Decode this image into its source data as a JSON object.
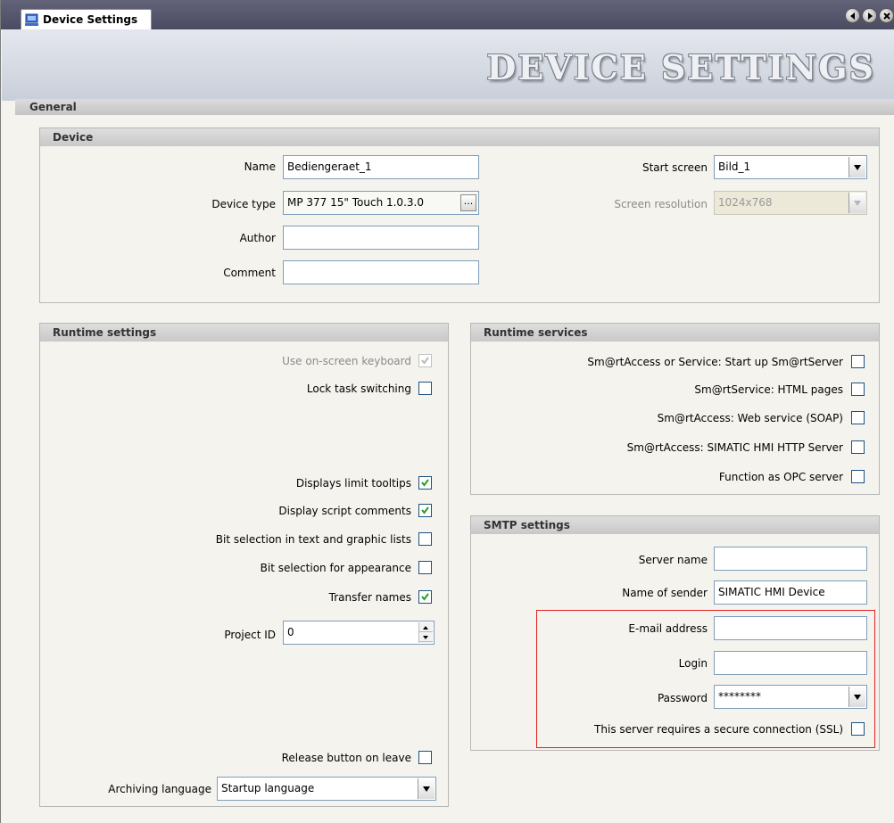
{
  "tab": {
    "title": "Device Settings"
  },
  "header": {
    "title": "DEVICE SETTINGS"
  },
  "general": {
    "label": "General"
  },
  "device": {
    "heading": "Device",
    "name_label": "Name",
    "name_value": "Bediengeraet_1",
    "device_type_label": "Device type",
    "device_type_value": "MP 377 15\" Touch 1.0.3.0",
    "browse_label": "...",
    "author_label": "Author",
    "author_value": "",
    "comment_label": "Comment",
    "comment_value": "",
    "start_screen_label": "Start screen",
    "start_screen_value": "Bild_1",
    "resolution_label": "Screen resolution",
    "resolution_value": "1024x768"
  },
  "runtime_settings": {
    "heading": "Runtime settings",
    "onscreen_keyboard": {
      "label": "Use on-screen keyboard",
      "checked": true,
      "disabled": true
    },
    "lock_task": {
      "label": "Lock task switching",
      "checked": false
    },
    "limit_tooltips": {
      "label": "Displays limit tooltips",
      "checked": true
    },
    "script_comments": {
      "label": "Display script comments",
      "checked": true
    },
    "bit_text_graphic": {
      "label": "Bit selection in text and graphic lists",
      "checked": false
    },
    "bit_appearance": {
      "label": "Bit selection for appearance",
      "checked": false
    },
    "transfer_names": {
      "label": "Transfer names",
      "checked": true
    },
    "project_id_label": "Project ID",
    "project_id_value": "0",
    "release_button": {
      "label": "Release button on leave",
      "checked": false
    },
    "archiving_language_label": "Archiving language",
    "archiving_language_value": "Startup language"
  },
  "runtime_services": {
    "heading": "Runtime services",
    "startup_server": {
      "label": "Sm@rtAccess or Service: Start up Sm@rtServer",
      "checked": false
    },
    "html_pages": {
      "label": "Sm@rtService: HTML pages",
      "checked": false
    },
    "web_service": {
      "label": "Sm@rtAccess: Web service (SOAP)",
      "checked": false
    },
    "http_server": {
      "label": "Sm@rtAccess: SIMATIC HMI HTTP Server",
      "checked": false
    },
    "opc_server": {
      "label": "Function as OPC server",
      "checked": false
    }
  },
  "smtp": {
    "heading": "SMTP settings",
    "server_name_label": "Server name",
    "server_name_value": "",
    "sender_label": "Name of sender",
    "sender_value": "SIMATIC HMI Device",
    "email_label": "E-mail address",
    "email_value": "",
    "login_label": "Login",
    "login_value": "",
    "password_label": "Password",
    "password_value": "********",
    "ssl": {
      "label": "This server requires a secure connection (SSL)",
      "checked": false
    }
  },
  "colors": {
    "checkmark": "#21a121",
    "highlight": "#e02020",
    "tabbar": "#55556b"
  }
}
